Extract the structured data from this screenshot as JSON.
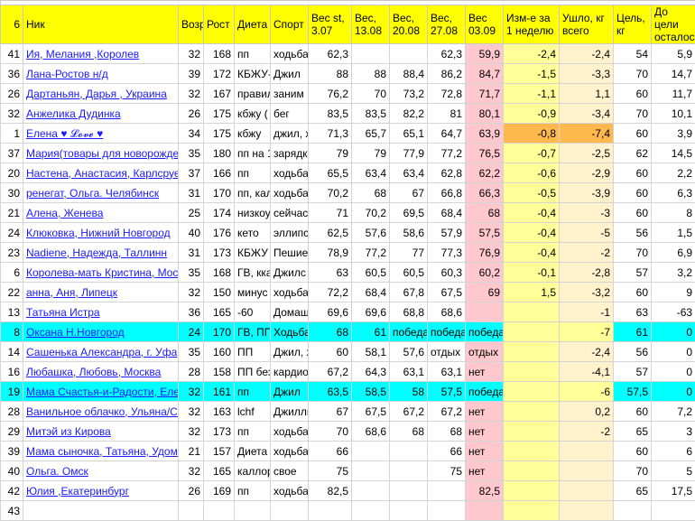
{
  "header": {
    "rank": "6",
    "nick": "Ник",
    "age": "Возраст",
    "height": "Рост",
    "diet": "Диета",
    "sport": "Спорт",
    "w0": "Вес st, 3.07",
    "w1": "Вес, 13.08",
    "w2": "Вес, 20.08",
    "w3": "Вес, 27.08",
    "w4": "Вес 03.09",
    "weekchange": "Изм-е за 1 неделю",
    "total": "Ушло, кг всего",
    "goal": "Цель, кг",
    "left": "До цели осталось"
  },
  "rows": [
    {
      "rank": "41",
      "nick": "Ия, Мелания ,Королев",
      "age": "32",
      "height": "168",
      "diet": "пп",
      "sport": "ходьба",
      "w0": "62,3",
      "w1": "",
      "w2": "",
      "w3": "62,3",
      "w4": "59,9",
      "weekchange": "-2,4",
      "total": "-2,4",
      "goal": "54",
      "left": "5,9",
      "hl": ""
    },
    {
      "rank": "36",
      "nick": "Лана-Ростов н/д",
      "age": "39",
      "height": "172",
      "diet": "КБЖУ-",
      "sport": "Джил",
      "w0": "88",
      "w1": "88",
      "w2": "88,4",
      "w3": "86,2",
      "w4": "84,7",
      "weekchange": "-1,5",
      "total": "-3,3",
      "goal": "70",
      "left": "14,7",
      "hl": ""
    },
    {
      "rank": "26",
      "nick": "Дартаньян, Дарья , Украина",
      "age": "32",
      "height": "167",
      "diet": "правил",
      "sport": "заним",
      "w0": "76,2",
      "w1": "70",
      "w2": "73,2",
      "w3": "72,8",
      "w4": "71,7",
      "weekchange": "-1,1",
      "total": "1,1",
      "goal": "60",
      "left": "11,7",
      "hl": ""
    },
    {
      "rank": "32",
      "nick": "Анжелика Дудинка",
      "age": "26",
      "height": "175",
      "diet": "кбжу (",
      "sport": "бег",
      "w0": "83,5",
      "w1": "83,5",
      "w2": "82,2",
      "w3": "81",
      "w4": "80,1",
      "weekchange": "-0,9",
      "total": "-3,4",
      "goal": "70",
      "left": "10,1",
      "hl": ""
    },
    {
      "rank": "1",
      "nick": "Елена ♥ 𝓛𝓸𝓿𝓮 ♥",
      "age": "34",
      "height": "175",
      "diet": "кбжу",
      "sport": "джил, х",
      "w0": "71,3",
      "w1": "65,7",
      "w2": "65,1",
      "w3": "64,7",
      "w4": "63,9",
      "weekchange": "-0,8",
      "total": "-7,4",
      "goal": "60",
      "left": "3,9",
      "hl": "orange"
    },
    {
      "rank": "37",
      "nick": "Мария(товары для новорожденных)",
      "age": "35",
      "height": "180",
      "diet": "пп на 1",
      "sport": "зарядка",
      "w0": "79",
      "w1": "79",
      "w2": "77,9",
      "w3": "77,2",
      "w4": "76,5",
      "weekchange": "-0,7",
      "total": "-2,5",
      "goal": "62",
      "left": "14,5",
      "hl": ""
    },
    {
      "rank": "20",
      "nick": "Настена, Анастасия, Карлсруе Германия",
      "age": "37",
      "height": "166",
      "diet": "пп",
      "sport": "ходьба",
      "w0": "65,5",
      "w1": "63,4",
      "w2": "63,4",
      "w3": "62,8",
      "w4": "62,2",
      "weekchange": "-0,6",
      "total": "-2,9",
      "goal": "60",
      "left": "2,2",
      "hl": ""
    },
    {
      "rank": "30",
      "nick": "ренегат, Ольга. Челябинск",
      "age": "31",
      "height": "170",
      "diet": "пп, кал",
      "sport": "ходьба",
      "w0": "70,2",
      "w1": "68",
      "w2": "67",
      "w3": "66,8",
      "w4": "66,3",
      "weekchange": "-0,5",
      "total": "-3,9",
      "goal": "60",
      "left": "6,3",
      "hl": ""
    },
    {
      "rank": "21",
      "nick": "Алена, Женева",
      "age": "25",
      "height": "174",
      "diet": "низкоу",
      "sport": "сейчас н",
      "w0": "71",
      "w1": "70,2",
      "w2": "69,5",
      "w3": "68,4",
      "w4": "68",
      "weekchange": "-0,4",
      "total": "-3",
      "goal": "60",
      "left": "8",
      "hl": ""
    },
    {
      "rank": "24",
      "nick": "Клюковка, Нижний Новгород",
      "age": "40",
      "height": "176",
      "diet": "кето",
      "sport": "эллипс,",
      "w0": "62,5",
      "w1": "57,6",
      "w2": "58,6",
      "w3": "57,9",
      "w4": "57,5",
      "weekchange": "-0,4",
      "total": "-5",
      "goal": "56",
      "left": "1,5",
      "hl": ""
    },
    {
      "rank": "23",
      "nick": "Nadiene, Надежда, Таллинн",
      "age": "31",
      "height": "173",
      "diet": "КБЖУ 1",
      "sport": "Пешие",
      "w0": "78,9",
      "w1": "77,2",
      "w2": "77",
      "w3": "77,3",
      "w4": "76,9",
      "weekchange": "-0,4",
      "total": "-2",
      "goal": "70",
      "left": "6,9",
      "hl": ""
    },
    {
      "rank": "6",
      "nick": "Королева-мать Кристина, Москва",
      "age": "35",
      "height": "168",
      "diet": "ГВ, кка",
      "sport": "Джилс",
      "w0": "63",
      "w1": "60,5",
      "w2": "60,5",
      "w3": "60,3",
      "w4": "60,2",
      "weekchange": "-0,1",
      "total": "-2,8",
      "goal": "57",
      "left": "3,2",
      "hl": ""
    },
    {
      "rank": "22",
      "nick": "анна, Аня, Липецк",
      "age": "32",
      "height": "150",
      "diet": "минус",
      "sport": "ходьба",
      "w0": "72,2",
      "w1": "68,4",
      "w2": "67,8",
      "w3": "67,5",
      "w4": "69",
      "weekchange": "1,5",
      "total": "-3,2",
      "goal": "60",
      "left": "9",
      "hl": ""
    },
    {
      "rank": "13",
      "nick": "Татьяна Истра",
      "age": "36",
      "height": "165",
      "diet": "-60",
      "sport": "Домаш",
      "w0": "69,6",
      "w1": "69,6",
      "w2": "68,8",
      "w3": "68,6",
      "w4": "",
      "weekchange": "",
      "total": "-1",
      "goal": "63",
      "left": "-63",
      "hl": ""
    },
    {
      "rank": "8",
      "nick": "Оксана Н.Новгород",
      "age": "24",
      "height": "170",
      "diet": "ГВ, ПП",
      "sport": "Ходьба,",
      "w0": "68",
      "w1": "61",
      "w2": "победа",
      "w3": "победа",
      "w4": "победа",
      "weekchange": "",
      "total": "-7",
      "goal": "61",
      "left": "0",
      "hl": "cyan"
    },
    {
      "rank": "14",
      "nick": "Сашенька Александра, г. Уфа",
      "age": "35",
      "height": "160",
      "diet": "ПП",
      "sport": "Джил, х",
      "w0": "60",
      "w1": "58,1",
      "w2": "57,6",
      "w3": "отдых",
      "w4": "отдых",
      "weekchange": "",
      "total": "-2,4",
      "goal": "56",
      "left": "0",
      "hl": ""
    },
    {
      "rank": "16",
      "nick": "Любашка, Любовь, Москва",
      "age": "28",
      "height": "158",
      "diet": "ПП без",
      "sport": "кардио",
      "w0": "67,2",
      "w1": "64,3",
      "w2": "63,1",
      "w3": "63,1",
      "w4": "нет",
      "weekchange": "",
      "total": "-4,1",
      "goal": "57",
      "left": "0",
      "hl": ""
    },
    {
      "rank": "19",
      "nick": "Мама Счастья-и-Радости, Елена",
      "age": "32",
      "height": "161",
      "diet": "пп",
      "sport": "Джил",
      "w0": "63,5",
      "w1": "58,5",
      "w2": "58",
      "w3": "57,5",
      "w4": "победа",
      "weekchange": "",
      "total": "-6",
      "goal": "57,5",
      "left": "0",
      "hl": "cyan"
    },
    {
      "rank": "28",
      "nick": "Ванильное облачко, Ульяна/СПб",
      "age": "32",
      "height": "163",
      "diet": "lchf",
      "sport": "Джилли",
      "w0": "67",
      "w1": "67,5",
      "w2": "67,2",
      "w3": "67,2",
      "w4": "нет",
      "weekchange": "",
      "total": "0,2",
      "goal": "60",
      "left": "7,2",
      "hl": ""
    },
    {
      "rank": "29",
      "nick": "Митэй из Кирова",
      "age": "32",
      "height": "173",
      "diet": "пп",
      "sport": "ходьба",
      "w0": "70",
      "w1": "68,6",
      "w2": "68",
      "w3": "68",
      "w4": "нет",
      "weekchange": "",
      "total": "-2",
      "goal": "65",
      "left": "3",
      "hl": ""
    },
    {
      "rank": "39",
      "nick": "Мама сыночка, Татьяна, Удомля",
      "age": "21",
      "height": "157",
      "diet": "Диета",
      "sport": "ходьба",
      "w0": "66",
      "w1": "",
      "w2": "",
      "w3": "66",
      "w4": "нет",
      "weekchange": "",
      "total": "",
      "goal": "60",
      "left": "6",
      "hl": ""
    },
    {
      "rank": "40",
      "nick": "Ольга. Омск",
      "age": "32",
      "height": "165",
      "diet": "каллор",
      "sport": "свое",
      "w0": "75",
      "w1": "",
      "w2": "",
      "w3": "75",
      "w4": "нет",
      "weekchange": "",
      "total": "",
      "goal": "70",
      "left": "5",
      "hl": ""
    },
    {
      "rank": "42",
      "nick": "Юлия ,Екатеринбург",
      "age": "26",
      "height": "169",
      "diet": "пп",
      "sport": "ходьба",
      "w0": "82,5",
      "w1": "",
      "w2": "",
      "w3": "",
      "w4": "82,5",
      "weekchange": "",
      "total": "",
      "goal": "65",
      "left": "17,5",
      "hl": ""
    },
    {
      "rank": "43",
      "nick": "",
      "age": "",
      "height": "",
      "diet": "",
      "sport": "",
      "w0": "",
      "w1": "",
      "w2": "",
      "w3": "",
      "w4": "",
      "weekchange": "",
      "total": "",
      "goal": "",
      "left": "",
      "hl": ""
    }
  ],
  "colors": {
    "header": "#ffff00",
    "week3": "#ffc7ce",
    "change": "#ffff99",
    "total": "#fff2cc",
    "winner": "#00ffff",
    "orange": "#ffb84d",
    "link": "#1a1aff"
  }
}
